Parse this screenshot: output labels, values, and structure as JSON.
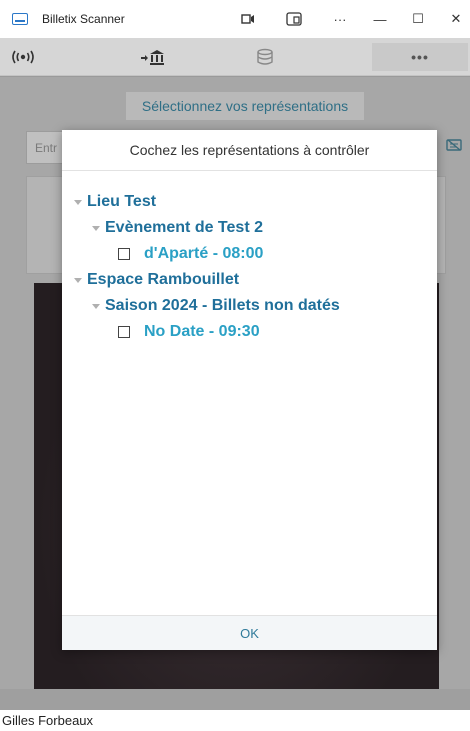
{
  "window": {
    "title": "Billetix Scanner",
    "controls": {
      "more": "···",
      "minimize": "—",
      "maximize": "☐",
      "close": "✕"
    }
  },
  "toolbar": {
    "icons": [
      "wifi-signal-icon",
      "bank-arrow-icon",
      "database-icon",
      "more-icon"
    ],
    "more_label": "•••"
  },
  "main": {
    "select_button": "Sélectionnez vos représentations",
    "scan_placeholder": "Entr"
  },
  "modal": {
    "title": "Cochez les représentations à contrôler",
    "tree": [
      {
        "label": "Lieu Test",
        "children": [
          {
            "label": "Evènement de Test 2",
            "leaves": [
              {
                "label": "d'Aparté - 08:00",
                "checked": false
              }
            ]
          }
        ]
      },
      {
        "label": "Espace Rambouillet",
        "children": [
          {
            "label": "Saison 2024 - Billets non datés",
            "leaves": [
              {
                "label": "No Date - 09:30",
                "checked": false
              }
            ]
          }
        ]
      }
    ],
    "ok_label": "OK"
  },
  "footer": {
    "user": "Gilles Forbeaux"
  },
  "colors": {
    "accent": "#2d8ab0",
    "leaf": "#2aa0c5",
    "overlay": "#a7a7a7"
  }
}
